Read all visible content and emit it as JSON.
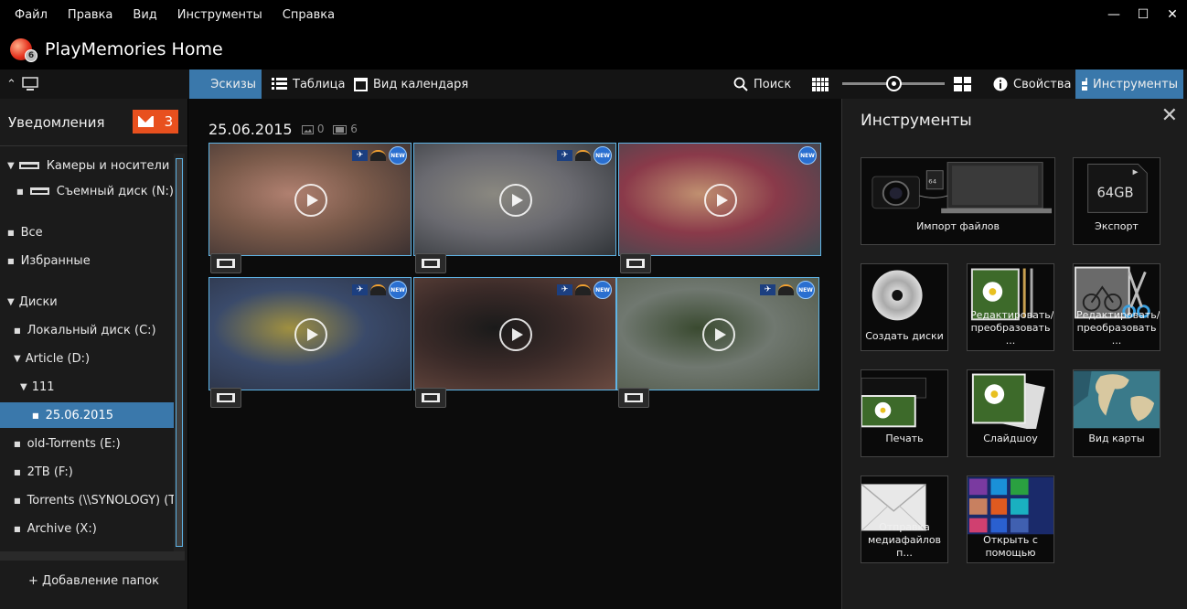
{
  "menu": [
    "Файл",
    "Правка",
    "Вид",
    "Инструменты",
    "Справка"
  ],
  "window_controls": {
    "minimize": "—",
    "maximize": "☐",
    "close": "✕"
  },
  "app": {
    "title": "PlayMemories Home",
    "logo_badge": "6"
  },
  "toolbar": {
    "tab_thumbnails": "Эскизы",
    "tab_table": "Таблица",
    "tab_calendar": "Вид календаря",
    "search": "Поиск",
    "properties": "Свойства",
    "tools": "Инструменты",
    "zoom_level": 0.5
  },
  "notifications": {
    "label": "Уведомления",
    "count": "3"
  },
  "tree": [
    {
      "label": "Камеры и носители",
      "kind": "group"
    },
    {
      "label": "Съемный диск (N:)",
      "kind": "drive"
    },
    {
      "label": "Все",
      "kind": "item"
    },
    {
      "label": "Избранные",
      "kind": "item"
    },
    {
      "label": "Диски",
      "kind": "group"
    },
    {
      "label": "Локальный диск (C:)",
      "kind": "item"
    },
    {
      "label": "Article (D:)",
      "kind": "group"
    },
    {
      "label": "111",
      "kind": "group"
    },
    {
      "label": "25.06.2015",
      "kind": "item",
      "selected": true
    },
    {
      "label": "old-Torrents (E:)",
      "kind": "item"
    },
    {
      "label": "2TB (F:)",
      "kind": "item"
    },
    {
      "label": "Torrents (\\\\SYNOLOGY) (T:",
      "kind": "item"
    },
    {
      "label": "Archive (X:)",
      "kind": "item"
    }
  ],
  "add_folders": "+ Добавление папок",
  "main": {
    "date": "25.06.2015",
    "photo_count": "0",
    "video_count": "6",
    "new_badge": "NEW",
    "videos": [
      {
        "badges": [
          "gps",
          "gauge",
          "new"
        ],
        "colors": [
          "#7a5a4a",
          "#b08070",
          "#3a3030"
        ]
      },
      {
        "badges": [
          "gps",
          "gauge",
          "new"
        ],
        "colors": [
          "#6a6a70",
          "#8a8880",
          "#303438"
        ]
      },
      {
        "badges": [
          "new"
        ],
        "colors": [
          "#8a3a4a",
          "#c09070",
          "#3a4a50"
        ]
      },
      {
        "badges": [
          "gps",
          "gauge",
          "new"
        ],
        "colors": [
          "#3a4a6a",
          "#a09040",
          "#2a3040"
        ]
      },
      {
        "badges": [
          "gps",
          "gauge",
          "new"
        ],
        "colors": [
          "#3a2a28",
          "#1a1a1a",
          "#6a4a40"
        ]
      },
      {
        "badges": [
          "gps",
          "gauge",
          "new"
        ],
        "colors": [
          "#707870",
          "#3a4a30",
          "#505848"
        ]
      }
    ]
  },
  "tools_panel": {
    "title": "Инструменты",
    "tiles": [
      {
        "label": "Импорт файлов",
        "icon": "camera-laptop-icon"
      },
      {
        "label": "Экспорт",
        "icon": "sd-card-icon",
        "card_text": "64GB"
      },
      {
        "label": "Создать диски",
        "icon": "disc-icon"
      },
      {
        "label": "Редактировать/ преобразовать ...",
        "icon": "flower-brush-icon"
      },
      {
        "label": "Редактировать/ преобразовать ...",
        "icon": "bike-scissors-icon"
      },
      {
        "label": "Печать",
        "icon": "printer-icon"
      },
      {
        "label": "Слайдшоу",
        "icon": "slideshow-icon"
      },
      {
        "label": "Вид карты",
        "icon": "map-icon"
      },
      {
        "label": "Отправка медиафайлов п...",
        "icon": "envelope-icon"
      },
      {
        "label": "Открыть с помощью",
        "icon": "tiles-icon"
      }
    ]
  },
  "colors": {
    "accent": "#3a78ab",
    "notif": "#e8501e",
    "thumb_border": "#5fb4e6"
  }
}
